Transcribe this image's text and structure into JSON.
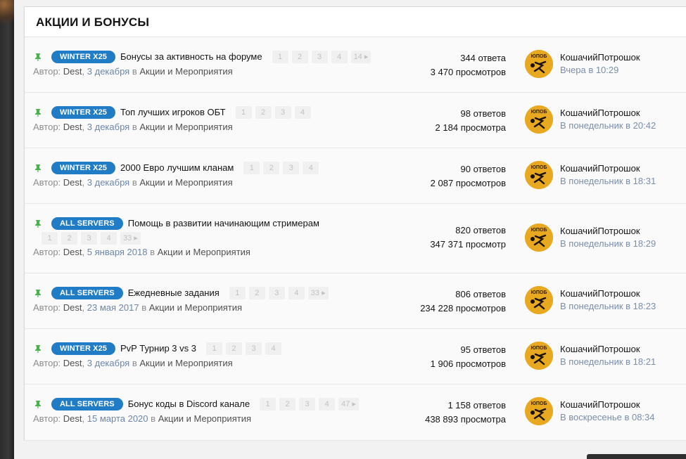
{
  "forum": {
    "title": "АКЦИИ И БОНУСЫ",
    "author_prefix": "Автор:",
    "in_word": "в",
    "accent_color": "#1f7cc5",
    "threads": [
      {
        "prefix": "WINTER X25",
        "title": "Бонусы за активность на форуме",
        "pages": [
          "1",
          "2",
          "3",
          "4",
          "14 ▸"
        ],
        "author": "Dest",
        "date": "3 декабря",
        "forum": "Акции и Мероприятия",
        "replies": "344 ответа",
        "views": "3 470 просмотров",
        "last_user": "КошачийПотрошок",
        "last_date": "Вчера в 10:29"
      },
      {
        "prefix": "WINTER X25",
        "title": "Топ лучших игроков ОБТ",
        "pages": [
          "1",
          "2",
          "3",
          "4"
        ],
        "author": "Dest",
        "date": "3 декабря",
        "forum": "Акции и Мероприятия",
        "replies": "98 ответов",
        "views": "2 184 просмотра",
        "last_user": "КошачийПотрошок",
        "last_date": "В понедельник в 20:42"
      },
      {
        "prefix": "WINTER X25",
        "title": "2000 Евро лучшим кланам",
        "pages": [
          "1",
          "2",
          "3",
          "4"
        ],
        "author": "Dest",
        "date": "3 декабря",
        "forum": "Акции и Мероприятия",
        "replies": "90 ответов",
        "views": "2 087 просмотров",
        "last_user": "КошачийПотрошок",
        "last_date": "В понедельник в 18:31"
      },
      {
        "prefix": "ALL SERVERS",
        "title": "Помощь в развитии начинающим стримерам",
        "pages": [
          "1",
          "2",
          "3",
          "4",
          "33 ▸"
        ],
        "author": "Dest",
        "date": "5 января 2018",
        "forum": "Акции и Мероприятия",
        "replies": "820 ответов",
        "views": "347 371 просмотр",
        "last_user": "КошачийПотрошок",
        "last_date": "В понедельник в 18:29"
      },
      {
        "prefix": "ALL SERVERS",
        "title": "Ежедневные задания",
        "pages": [
          "1",
          "2",
          "3",
          "4",
          "33 ▸"
        ],
        "author": "Dest",
        "date": "23 мая 2017",
        "forum": "Акции и Мероприятия",
        "replies": "806 ответов",
        "views": "234 228 просмотров",
        "last_user": "КошачийПотрошок",
        "last_date": "В понедельник в 18:23"
      },
      {
        "prefix": "WINTER X25",
        "title": "PvP Турнир 3 vs 3",
        "pages": [
          "1",
          "2",
          "3",
          "4"
        ],
        "author": "Dest",
        "date": "3 декабря",
        "forum": "Акции и Мероприятия",
        "replies": "95 ответов",
        "views": "1 906 просмотров",
        "last_user": "КошачийПотрошок",
        "last_date": "В понедельник в 18:21"
      },
      {
        "prefix": "ALL SERVERS",
        "title": "Бонус коды в Discord канале",
        "pages": [
          "1",
          "2",
          "3",
          "4",
          "47 ▸"
        ],
        "author": "Dest",
        "date": "15 марта 2020",
        "forum": "Акции и Мероприятия",
        "replies": "1 158 ответов",
        "views": "438 893 просмотра",
        "last_user": "КошачийПотрошок",
        "last_date": "В воскресенье в 08:34"
      }
    ]
  }
}
